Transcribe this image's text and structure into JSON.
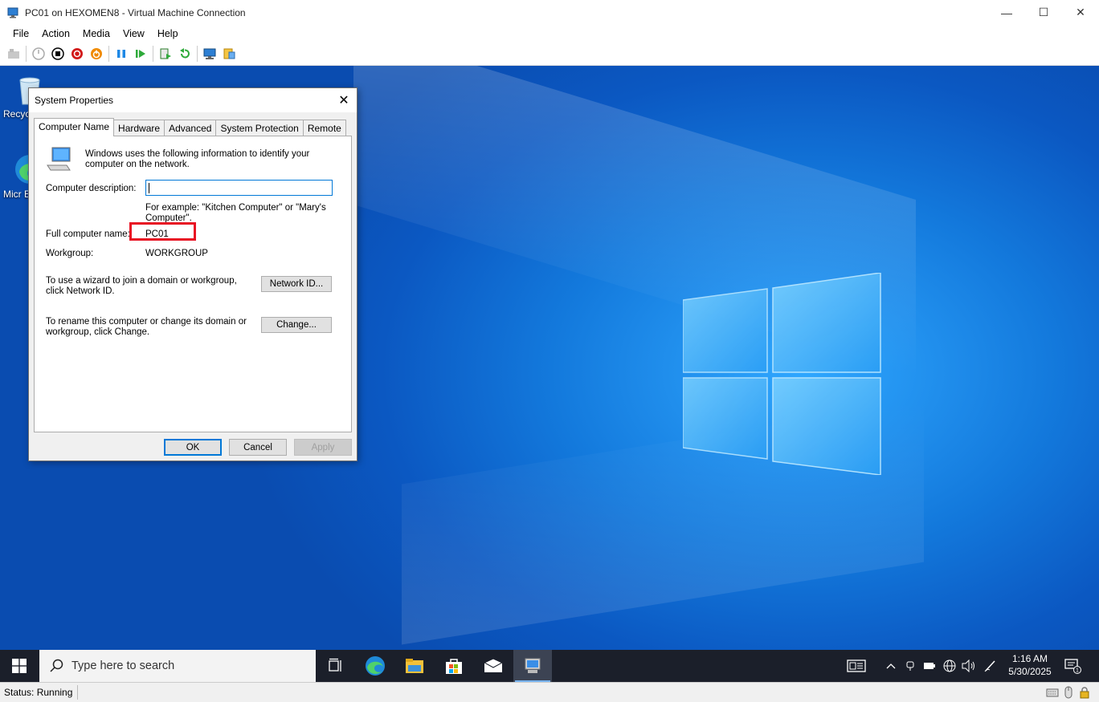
{
  "window": {
    "title": "PC01 on HEXOMEN8 - Virtual Machine Connection",
    "minimize_icon": "—",
    "maximize_icon": "☐",
    "close_icon": "✕"
  },
  "menu": [
    "File",
    "Action",
    "Media",
    "View",
    "Help"
  ],
  "desktop": {
    "icons": [
      {
        "label": "Recyc"
      },
      {
        "label": "Micr Ec"
      }
    ]
  },
  "dialog": {
    "title": "System Properties",
    "close_icon": "✕",
    "tabs": [
      "Computer Name",
      "Hardware",
      "Advanced",
      "System Protection",
      "Remote"
    ],
    "intro_text": "Windows uses the following information to identify your computer on the network.",
    "description_label": "Computer description:",
    "description_value": "",
    "example_text": "For example: \"Kitchen Computer\" or \"Mary's Computer\".",
    "full_name_label": "Full computer name:",
    "full_name_value": "PC01",
    "workgroup_label": "Workgroup:",
    "workgroup_value": "WORKGROUP",
    "wizard_text": "To use a wizard to join a domain or workgroup, click Network ID.",
    "network_id_button": "Network ID...",
    "rename_text": "To rename this computer or change its domain or workgroup, click Change.",
    "change_button": "Change...",
    "ok_button": "OK",
    "cancel_button": "Cancel",
    "apply_button": "Apply"
  },
  "taskbar": {
    "search_placeholder": "Type here to search",
    "time": "1:16 AM",
    "date": "5/30/2025",
    "notification_count": "1"
  },
  "status": {
    "text": "Status: Running"
  },
  "colors": {
    "highlight_box": "#e81123",
    "accent": "#0078d7",
    "taskbar": "#1b1f2a"
  }
}
